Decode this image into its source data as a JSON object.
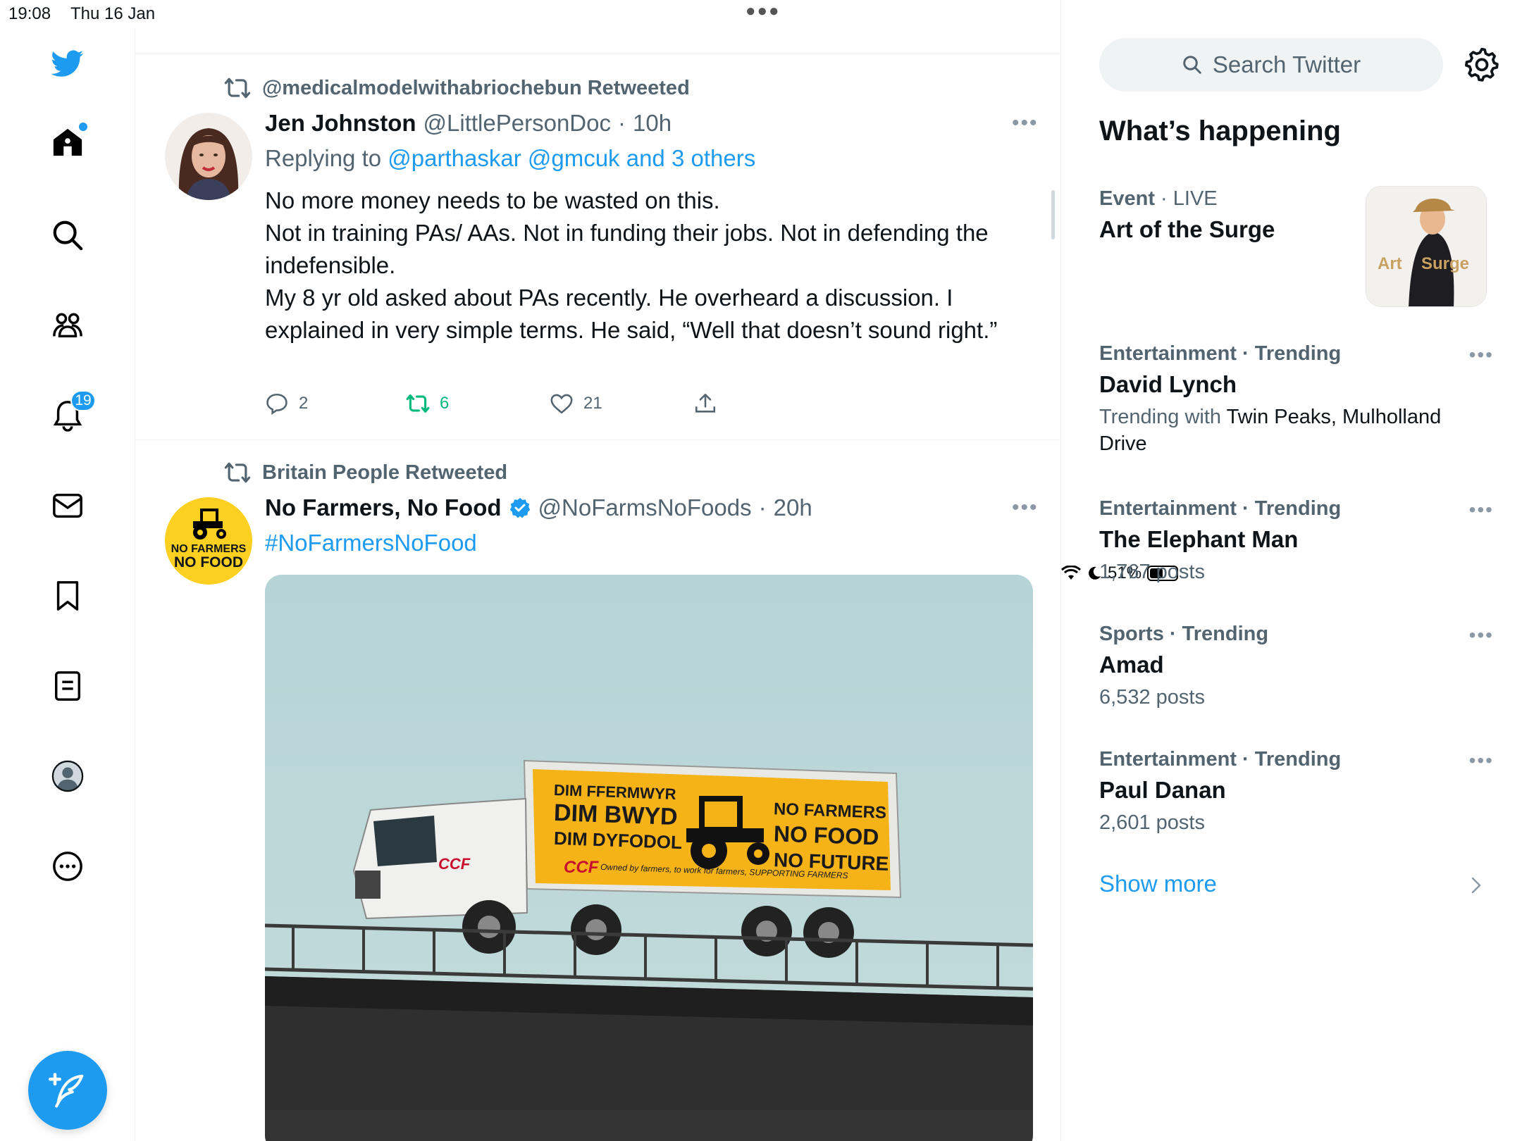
{
  "status_bar": {
    "time": "19:08",
    "date": "Thu 16 Jan",
    "battery_level": 0.51,
    "battery_text": "51%"
  },
  "nav": {
    "notifications_count": "19",
    "colors": {
      "brand": "#1d9bf0"
    }
  },
  "timeline": {
    "tweets": [
      {
        "retweeted_by": "@medicalmodelwithabriochebun Retweeted",
        "name": "Jen Johnston",
        "handle": "@LittlePersonDoc",
        "sep": "·",
        "time": "10h",
        "replying_prefix": "Replying to",
        "replying_links": "@parthaskar @gmcuk and 3 others",
        "body": [
          "No more money needs to be wasted on this.",
          "Not in training PAs/ AAs. Not in funding their jobs. Not in defending the indefensible.",
          "My 8 yr old asked about PAs recently. He overheard a discussion. I explained in very simple terms. He said, “Well that doesn’t sound right.”"
        ],
        "replies": "2",
        "retweets": "6",
        "likes": "21"
      },
      {
        "retweeted_by": "Britain People Retweeted",
        "name": "No Farmers, No Food",
        "handle": "@NoFarmsNoFoods",
        "sep": "·",
        "time": "20h",
        "hashtag": "#NoFarmersNoFood",
        "avatar_text_1": "NO FARMERS",
        "avatar_text_2": "NO FOOD",
        "media": {
          "sign_left_1": "DIM FFERMWYR",
          "sign_left_2": "DIM BWYD",
          "sign_left_3": "DIM DYFODOL",
          "sign_right_1": "NO FARMERS",
          "sign_right_2": "NO FOOD",
          "sign_right_3": "NO FUTURE",
          "cab_logo": "CCF",
          "tagline": "Owned by farmers, to work for farmers, SUPPORTING FARMERS"
        }
      }
    ]
  },
  "sidebar": {
    "search_placeholder": "Search Twitter",
    "whats_happening": "What’s happening",
    "trends": [
      {
        "category": "Event",
        "dot": "·",
        "extra": "LIVE",
        "title": "Art of the Surge",
        "image_text_1": "Art",
        "image_text_2": "Surge"
      },
      {
        "category": "Entertainment · Trending",
        "title": "David Lynch",
        "sub_prefix": "Trending with",
        "sub_value": "Twin Peaks, Mulholland Drive"
      },
      {
        "category": "Entertainment · Trending",
        "title": "The Elephant Man",
        "sub": "1,767 posts"
      },
      {
        "category": "Sports · Trending",
        "title": "Amad",
        "sub": "6,532 posts"
      },
      {
        "category": "Entertainment · Trending",
        "title": "Paul Danan",
        "sub": "2,601 posts"
      }
    ],
    "show_more": "Show more"
  }
}
